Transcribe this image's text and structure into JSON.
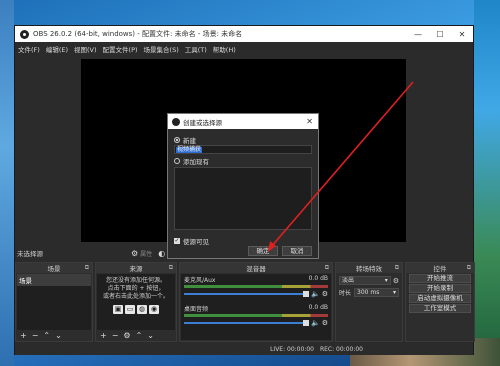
{
  "window": {
    "title": "OBS 26.0.2 (64-bit, windows) - 配置文件: 未命名 - 场景: 未命名",
    "minimize": "—",
    "maximize": "☐",
    "close": "✕"
  },
  "menu": [
    "文件(F)",
    "编辑(E)",
    "视图(V)",
    "配置文件(P)",
    "场景集合(S)",
    "工具(T)",
    "帮助(H)"
  ],
  "scene_bar": {
    "no_source": "未选择源",
    "properties": "属性",
    "filters_icon": "filter-icon"
  },
  "docks": {
    "scenes": {
      "title": "场景",
      "items": [
        "场景"
      ]
    },
    "sources": {
      "title": "来源",
      "empty_lines": [
        "您还没有添加任何源。",
        "点击下面的 + 按钮，",
        "或者右击此处添加一个。"
      ]
    },
    "mixer": {
      "title": "混音器",
      "channels": [
        {
          "name": "麦克风/Aux",
          "level": "0.0 dB"
        },
        {
          "name": "桌面音频",
          "level": "0.0 dB"
        }
      ]
    },
    "transitions": {
      "title": "转场特效",
      "type": "淡出",
      "duration_label": "时长",
      "duration_value": "300 ms"
    },
    "controls": {
      "title": "控件",
      "buttons": [
        "开始推流",
        "开始录制",
        "启动虚拟摄像机",
        "工作室模式"
      ]
    }
  },
  "status": {
    "live": "LIVE: 00:00:00",
    "rec": "REC: 00:00:00"
  },
  "dialog": {
    "title": "创建或选择源",
    "new_label": "新建",
    "name_value": "视频捕获",
    "add_existing": "添加现有",
    "visible_label": "使源可见",
    "ok": "确定",
    "cancel": "取消"
  },
  "colors": {
    "annotation_arrow": "#e02020",
    "accent": "#2f6ccf"
  }
}
